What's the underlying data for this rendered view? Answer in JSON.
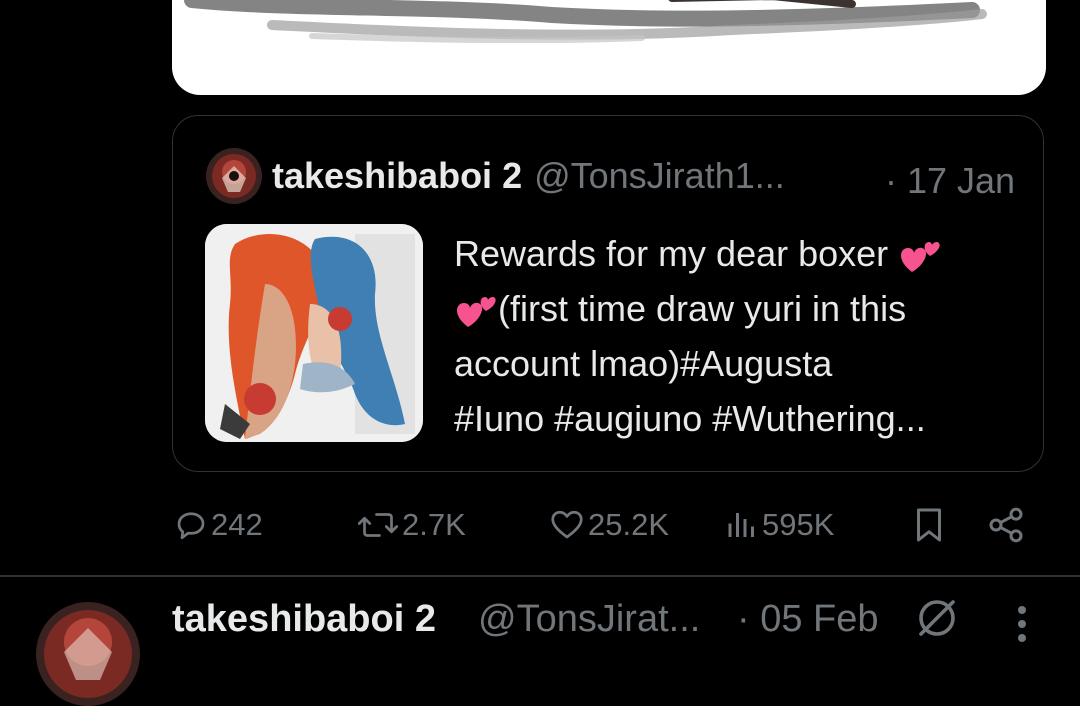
{
  "top_media": {
    "description_icon": "image-attachment"
  },
  "quote": {
    "display_name": "takeshibaboi 2",
    "handle": "@TonsJirath1...",
    "date": "· 17 Jan",
    "text_lines": [
      "Rewards for my dear boxer",
      "(first time draw yuri in this",
      "account lmao)#Augusta",
      "#Iuno #augiuno #Wuthering..."
    ],
    "emoji": "revolving-hearts-icon"
  },
  "actions": {
    "replies": "242",
    "reposts": "2.7K",
    "likes": "25.2K",
    "views": "595K"
  },
  "next_tweet": {
    "display_name": "takeshibaboi 2",
    "handle": "@TonsJirat...",
    "date": "· 05 Feb"
  },
  "colors": {
    "background": "#000000",
    "text_primary": "#e7e9ea",
    "text_secondary": "#71767b",
    "border": "#2f3336",
    "heart_pink": "#f7538f"
  }
}
